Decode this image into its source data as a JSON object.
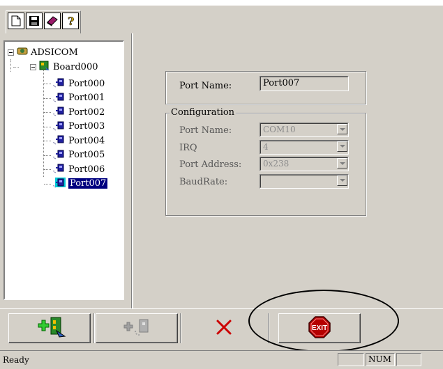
{
  "toolbar": {
    "buttons": [
      {
        "name": "new",
        "icon": "new-document-icon"
      },
      {
        "name": "save",
        "icon": "save-disk-icon"
      },
      {
        "name": "book",
        "icon": "book-icon"
      },
      {
        "name": "help",
        "icon": "help-question-icon"
      }
    ]
  },
  "tree": {
    "root": "ADSICOM",
    "board": "Board000",
    "ports": [
      "Port000",
      "Port001",
      "Port002",
      "Port003",
      "Port004",
      "Port005",
      "Port006",
      "Port007"
    ],
    "selected": "Port007"
  },
  "details": {
    "port_name_label": "Port Name:",
    "port_name_value": "Port007",
    "config_title": "Configuration",
    "fields": [
      {
        "label": "Port Name:",
        "value": "COM10"
      },
      {
        "label": "IRQ",
        "value": "4"
      },
      {
        "label": "Port Address:",
        "value": "0x238"
      },
      {
        "label": "BaudRate:",
        "value": ""
      }
    ]
  },
  "bottom_buttons": [
    {
      "name": "add-board",
      "icon": "add-board-icon",
      "enabled": true
    },
    {
      "name": "add-port",
      "icon": "add-port-icon",
      "enabled": false
    },
    {
      "name": "delete",
      "icon": "delete-x-icon",
      "enabled": true
    },
    {
      "name": "exit",
      "icon": "exit-stop-sign-icon",
      "label": "EXIT",
      "enabled": true
    }
  ],
  "status": {
    "text": "Ready",
    "num": "NUM"
  },
  "colors": {
    "background": "#d4d0c8",
    "selection": "#000080",
    "delete_x": "#cc0000",
    "exit_sign": "#b50000"
  }
}
